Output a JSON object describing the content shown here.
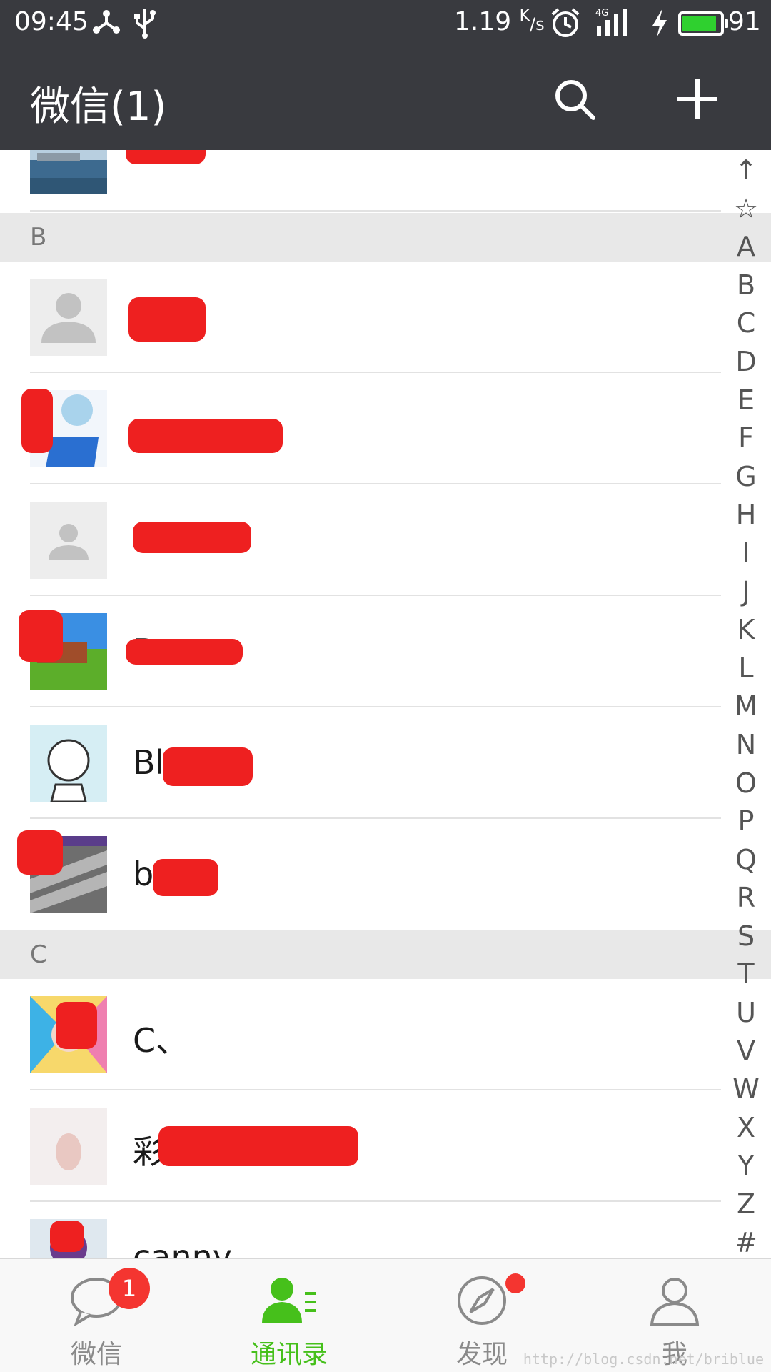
{
  "status_bar": {
    "time": "09:45",
    "net_speed": "1.19",
    "net_unit_top": "K",
    "net_unit_bottom": "/s",
    "signal_type": "4G",
    "battery_percent": "91",
    "battery_level": 0.91,
    "battery_color": "#2fd02f",
    "icons": [
      "network-share-icon",
      "usb-icon",
      "alarm-icon",
      "signal-icon",
      "charging-icon",
      "battery-icon"
    ]
  },
  "header": {
    "title": "微信(1)",
    "background": "#393a3f",
    "search_icon": "search-icon",
    "add_icon": "plus-icon"
  },
  "sections": [
    {
      "letter": "B"
    },
    {
      "letter": "C"
    }
  ],
  "contacts": [
    {
      "name": "",
      "avatar": "sea-photo"
    },
    {
      "name": "",
      "avatar": "default-person"
    },
    {
      "name": "",
      "avatar": "anime-photo"
    },
    {
      "name": "",
      "avatar": "default-person"
    },
    {
      "name": "B",
      "avatar": "landscape-photo"
    },
    {
      "name": "Bl",
      "avatar": "cartoon-boy"
    },
    {
      "name": "b",
      "avatar": "plaid-photo"
    },
    {
      "name": "C、",
      "avatar": "comic-girl"
    },
    {
      "name": "彩",
      "avatar": "hand-photo"
    },
    {
      "name": "canny",
      "avatar": "dark-photo"
    }
  ],
  "index_letters": [
    "↑",
    "☆",
    "A",
    "B",
    "C",
    "D",
    "E",
    "F",
    "G",
    "H",
    "I",
    "J",
    "K",
    "L",
    "M",
    "N",
    "O",
    "P",
    "Q",
    "R",
    "S",
    "T",
    "U",
    "V",
    "W",
    "X",
    "Y",
    "Z",
    "#"
  ],
  "tabs": [
    {
      "label": "微信",
      "icon": "chat-bubble-icon",
      "badge": "1",
      "active": false
    },
    {
      "label": "通讯录",
      "icon": "contacts-icon",
      "active": true
    },
    {
      "label": "发现",
      "icon": "compass-icon",
      "has_dot": true,
      "active": false
    },
    {
      "label": "我",
      "icon": "person-icon",
      "active": false
    }
  ],
  "colors": {
    "accent_green": "#46c01b",
    "badge_red": "#f43530",
    "redaction_red": "#ee2020"
  },
  "watermark": "http://blog.csdn.net/briblue"
}
